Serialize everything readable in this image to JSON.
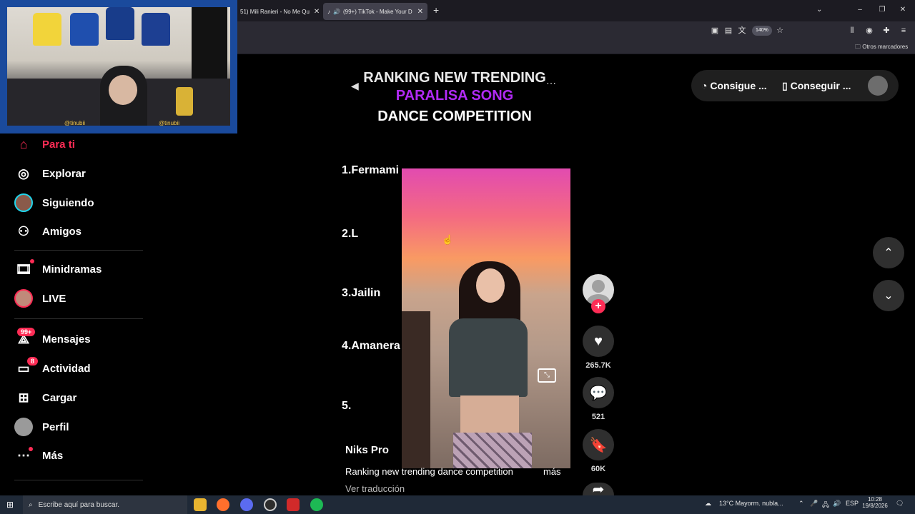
{
  "browser": {
    "tabs": [
      {
        "label": "51) Mili Ranieri - No Me Qu"
      },
      {
        "label": "(99+) TikTok - Make Your D"
      }
    ],
    "zoom": "140%",
    "bookmarks_other": "Otros marcadores"
  },
  "webcam": {
    "handle_left": "@tinubii_",
    "handle_right": "@tinubii_"
  },
  "sidebar": {
    "items": [
      {
        "label": "Para ti",
        "icon": "home-icon",
        "active": true
      },
      {
        "label": "Explorar",
        "icon": "compass-icon"
      },
      {
        "label": "Siguiendo",
        "icon": "following-avatar-icon"
      },
      {
        "label": "Amigos",
        "icon": "friends-icon"
      },
      {
        "label": "Minidramas",
        "icon": "film-icon"
      },
      {
        "label": "LIVE",
        "icon": "live-avatar-icon"
      },
      {
        "label": "Mensajes",
        "icon": "messages-icon",
        "badge": "99+"
      },
      {
        "label": "Actividad",
        "icon": "activity-icon",
        "badge": "8"
      },
      {
        "label": "Cargar",
        "icon": "upload-icon"
      },
      {
        "label": "Perfil",
        "icon": "profile-icon"
      },
      {
        "label": "Más",
        "icon": "more-icon"
      }
    ]
  },
  "video": {
    "title_line1": "RANKING NEW TRENDING",
    "title_line2": "PARALISA SONG",
    "title_line3": "DANCE COMPETITION",
    "ranks": [
      "1.Fermami",
      "2.L",
      "3.Jailin",
      "4.Amanera",
      "5."
    ],
    "author": "Niks Pro",
    "description": "Ranking new trending dance competition",
    "more": "más",
    "translate": "Ver traducción"
  },
  "actions": {
    "likes": "265.7K",
    "comments": "521",
    "saves": "60K"
  },
  "top_right": {
    "btn1": "Consigue ...",
    "btn2": "Conseguir ..."
  },
  "taskbar": {
    "search_placeholder": "Escribe aquí para buscar.",
    "weather": "13°C  Mayorm. nubla...",
    "lang": "ESP",
    "time": "10:28",
    "date": "19/8/2026"
  },
  "colors": {
    "accent": "#fe2c55",
    "title_purple": "#b12af5",
    "background": "#000000"
  }
}
